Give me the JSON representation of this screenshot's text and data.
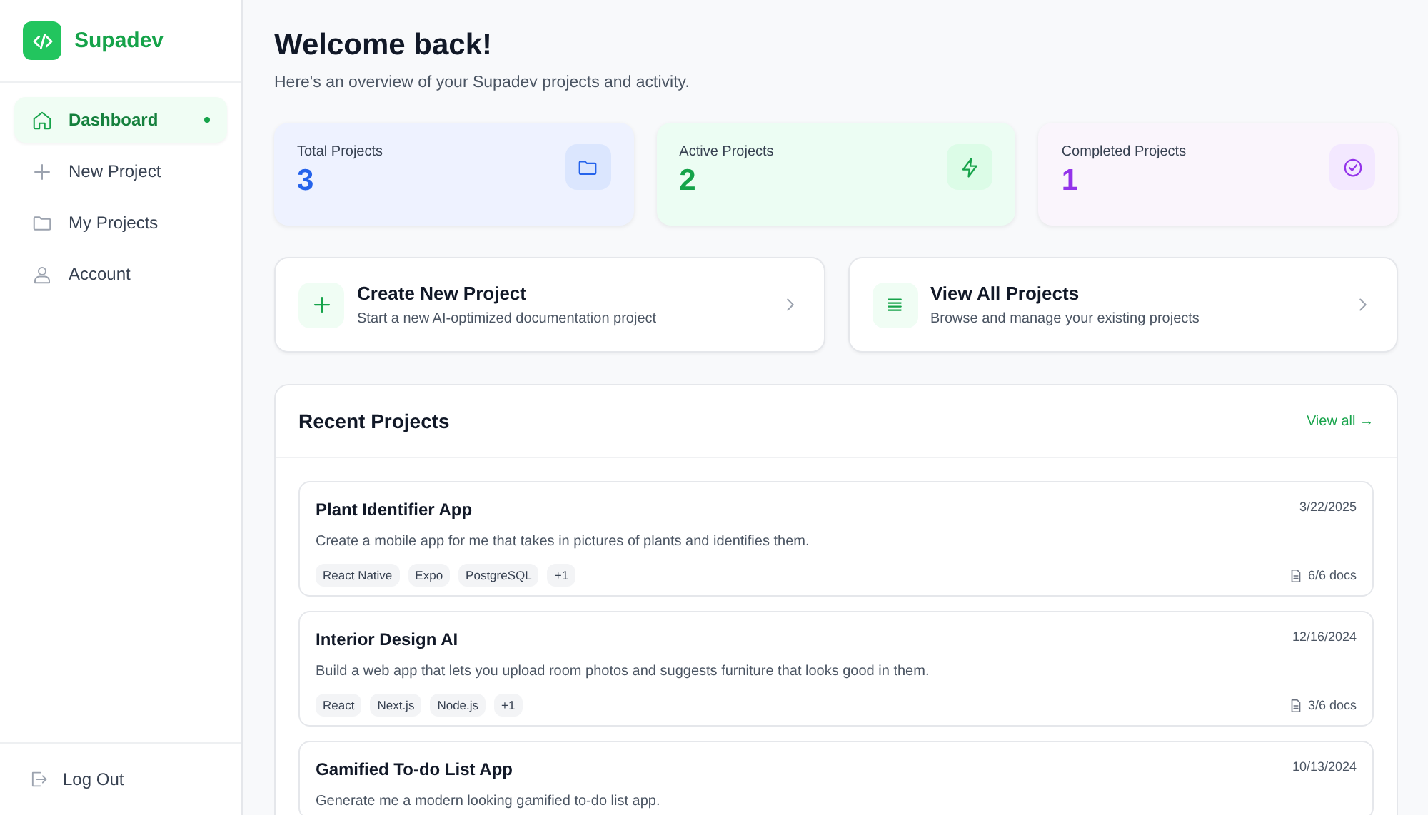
{
  "brand": {
    "name": "Supadev"
  },
  "sidebar": {
    "items": [
      {
        "label": "Dashboard",
        "kind": "home",
        "selected": true
      },
      {
        "label": "New Project",
        "kind": "plus",
        "selected": false
      },
      {
        "label": "My Projects",
        "kind": "folder",
        "selected": false
      },
      {
        "label": "Account",
        "kind": "user",
        "selected": false
      }
    ],
    "footer": {
      "label": "Log Out"
    }
  },
  "header": {
    "title": "Welcome back!",
    "subtitle": "Here's an overview of your Supadev projects and activity."
  },
  "stats": [
    {
      "label": "Total Projects",
      "value": "3",
      "kind": "folder",
      "color": "#2563eb"
    },
    {
      "label": "Active Projects",
      "value": "2",
      "kind": "bolt",
      "color": "#16a34a"
    },
    {
      "label": "Completed Projects",
      "value": "1",
      "kind": "check",
      "color": "#9333ea"
    }
  ],
  "actions": [
    {
      "title": "Create New Project",
      "description": "Start a new AI-optimized documentation project",
      "kind": "plus"
    },
    {
      "title": "View All Projects",
      "description": "Browse and manage your existing projects",
      "kind": "list"
    }
  ],
  "recent": {
    "title": "Recent Projects",
    "link": "View all →",
    "projects": [
      {
        "name": "Plant Identifier App",
        "date": "3/22/2025",
        "description": "Create a mobile app for me that takes in pictures of plants and identifies them.",
        "tags": [
          "React Native",
          "Expo",
          "PostgreSQL",
          "+1"
        ],
        "docs": "6/6 docs"
      },
      {
        "name": "Interior Design AI",
        "date": "12/16/2024",
        "description": "Build a web app that lets you upload room photos and suggests furniture that looks good in them.",
        "tags": [
          "React",
          "Next.js",
          "Node.js",
          "+1"
        ],
        "docs": "3/6 docs"
      },
      {
        "name": "Gamified To-do List App",
        "date": "10/13/2024",
        "description": "Generate me a modern looking gamified to-do list app."
      }
    ]
  }
}
